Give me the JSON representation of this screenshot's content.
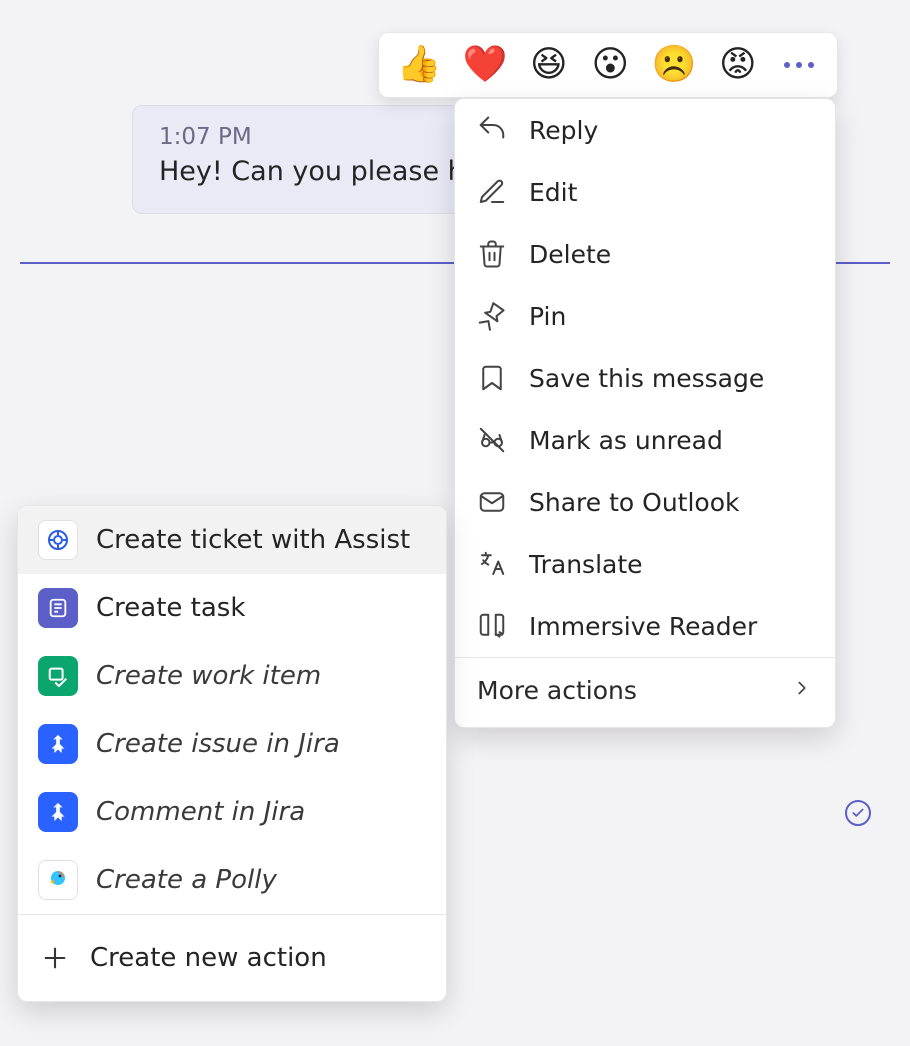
{
  "message": {
    "time": "1:07 PM",
    "text": "Hey! Can you please he"
  },
  "reactions": [
    {
      "name": "like",
      "emoji": "👍"
    },
    {
      "name": "heart",
      "emoji": "❤️"
    },
    {
      "name": "laugh",
      "emoji": "😆"
    },
    {
      "name": "surprised",
      "emoji": "😮"
    },
    {
      "name": "sad",
      "emoji": "☹️"
    },
    {
      "name": "angry",
      "emoji": "😡"
    }
  ],
  "menu": {
    "items": [
      {
        "icon": "reply",
        "label": "Reply"
      },
      {
        "icon": "edit",
        "label": "Edit"
      },
      {
        "icon": "delete",
        "label": "Delete"
      },
      {
        "icon": "pin",
        "label": "Pin"
      },
      {
        "icon": "bookmark",
        "label": "Save this message"
      },
      {
        "icon": "unread",
        "label": "Mark as unread"
      },
      {
        "icon": "mail",
        "label": "Share to Outlook"
      },
      {
        "icon": "translate",
        "label": "Translate"
      },
      {
        "icon": "reader",
        "label": "Immersive Reader"
      }
    ],
    "more_label": "More actions"
  },
  "submenu": {
    "items": [
      {
        "icon": "assist",
        "label": "Create ticket with Assist",
        "italic": false,
        "highlight": true
      },
      {
        "icon": "task",
        "label": "Create task",
        "italic": false
      },
      {
        "icon": "work",
        "label": "Create work item",
        "italic": true
      },
      {
        "icon": "jira",
        "label": "Create issue in Jira",
        "italic": true
      },
      {
        "icon": "jira",
        "label": "Comment in Jira",
        "italic": true
      },
      {
        "icon": "polly",
        "label": "Create a Polly",
        "italic": true
      }
    ],
    "create_label": "Create new action"
  }
}
